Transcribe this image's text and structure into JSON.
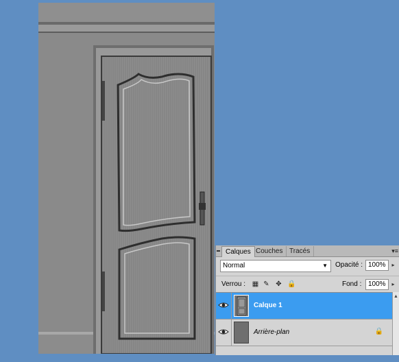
{
  "panel": {
    "tabs": [
      "Calques",
      "Couches",
      "Tracés"
    ],
    "active_tab": "Calques",
    "menu_icon": "panel-menu-icon"
  },
  "blend": {
    "mode": "Normal"
  },
  "opacity": {
    "label": "Opacité :",
    "value": "100%"
  },
  "lock": {
    "label": "Verrou :"
  },
  "fill": {
    "label": "Fond :",
    "value": "100%"
  },
  "layers": [
    {
      "name": "Calque 1",
      "selected": true,
      "visible": true
    },
    {
      "name": "Arrière-plan",
      "selected": false,
      "visible": true,
      "locked": true
    }
  ],
  "colors": {
    "workspace": "#5f8ec2",
    "panel": "#d4d4d4",
    "selection": "#3b9cf0"
  }
}
